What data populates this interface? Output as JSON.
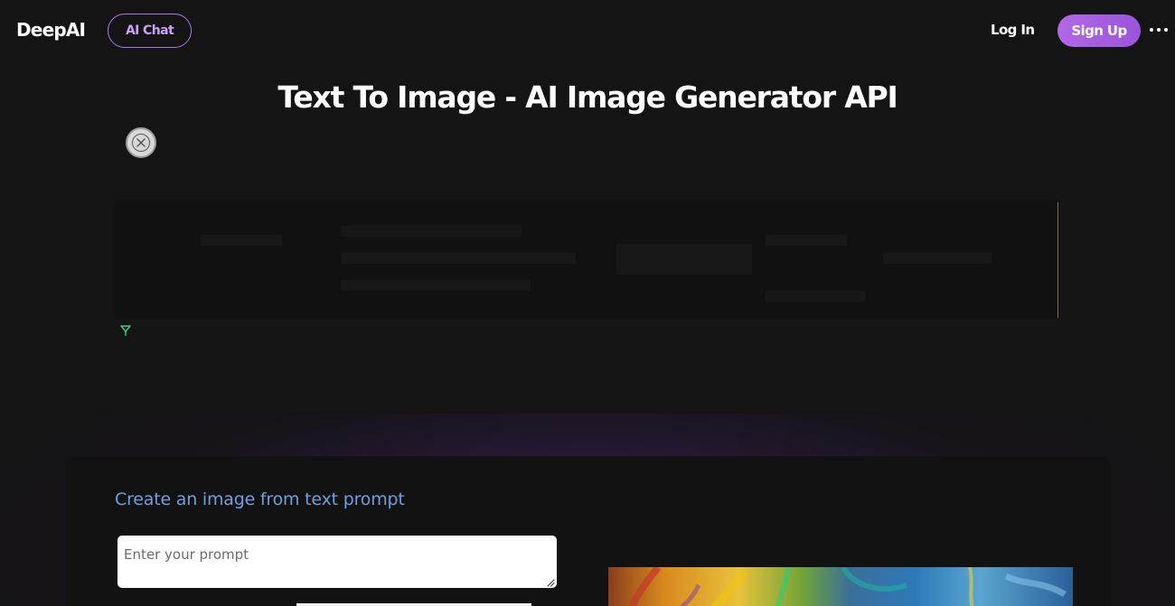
{
  "header": {
    "logo": "DeepAI",
    "ai_chat_label": "AI Chat",
    "login_label": "Log In",
    "signup_label": "Sign Up",
    "more_icon": "more-horizontal-icon"
  },
  "page_title": "Text To Image - AI Image Generator API",
  "close_icon": "close-icon",
  "ad": {
    "icon": "ad-choices-icon"
  },
  "generator": {
    "heading": "Create an image from text prompt",
    "prompt_placeholder": "Enter your prompt",
    "prompt_value": ""
  },
  "colors": {
    "background": "#141414",
    "accent_purple": "#a878e8",
    "heading_blue": "#6f9fe0"
  }
}
